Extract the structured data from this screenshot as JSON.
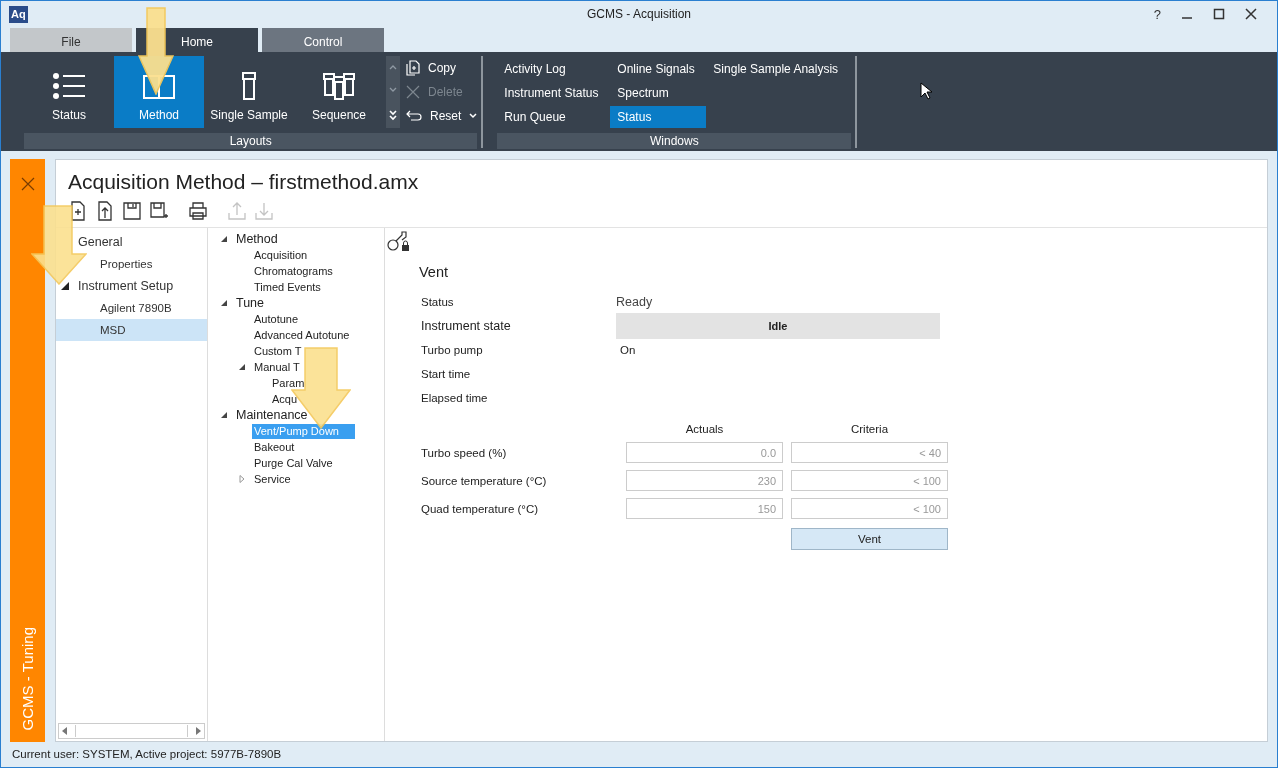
{
  "window": {
    "logo_text": "Aq",
    "title": "GCMS - Acquisition",
    "help": "?"
  },
  "ribbon_tabs": [
    {
      "label": "File",
      "selected": false
    },
    {
      "label": "Home",
      "selected": true
    },
    {
      "label": "Control",
      "selected": false
    }
  ],
  "layouts": {
    "label": "Layouts",
    "items": [
      {
        "label": "Status",
        "kind": "list",
        "selected": false
      },
      {
        "label": "Method",
        "kind": "book",
        "selected": true
      },
      {
        "label": "Single Sample",
        "kind": "vial",
        "selected": false
      },
      {
        "label": "Sequence",
        "kind": "vials",
        "selected": false
      }
    ]
  },
  "edit_actions": [
    {
      "label": "Copy",
      "kind": "copy",
      "disabled": false
    },
    {
      "label": "Delete",
      "kind": "delete",
      "disabled": true
    },
    {
      "label": "Reset",
      "kind": "reset",
      "disabled": false
    }
  ],
  "windows": {
    "label": "Windows",
    "items": [
      {
        "label": "Activity Log",
        "selected": false
      },
      {
        "label": "Instrument Status",
        "selected": false
      },
      {
        "label": "Run Queue",
        "selected": false
      },
      {
        "label": "Online Signals",
        "selected": false
      },
      {
        "label": "Spectrum",
        "selected": false
      },
      {
        "label": "Status",
        "selected": true
      },
      {
        "label": "Single Sample Analysis",
        "selected": false
      }
    ]
  },
  "side_panel": {
    "title": "GCMS - Tuning"
  },
  "document": {
    "title": "Acquisition Method – firstmethod.amx",
    "toolbar": [
      {
        "kind": "new",
        "disabled": false
      },
      {
        "kind": "open",
        "disabled": false
      },
      {
        "kind": "save",
        "disabled": false
      },
      {
        "kind": "save-as",
        "disabled": false
      },
      {
        "kind": "print",
        "disabled": false
      },
      {
        "kind": "upload",
        "disabled": true
      },
      {
        "kind": "download",
        "disabled": true
      }
    ]
  },
  "left_tree": [
    {
      "label": "General",
      "selected": false,
      "children": [
        {
          "label": "Properties",
          "selected": false
        }
      ]
    },
    {
      "label": "Instrument Setup",
      "expanded": true,
      "selected": false,
      "children": [
        {
          "label": "Agilent 7890B",
          "selected": false
        },
        {
          "label": "MSD",
          "selected": true
        }
      ]
    }
  ],
  "middle_tree": [
    {
      "label": "Method",
      "expanded": true,
      "selected": false,
      "children": [
        {
          "label": "Acquisition",
          "selected": false
        },
        {
          "label": "Chromatograms",
          "selected": false
        },
        {
          "label": "Timed Events",
          "selected": false
        }
      ]
    },
    {
      "label": "Tune",
      "expanded": true,
      "selected": false,
      "children": [
        {
          "label": "Autotune",
          "selected": false
        },
        {
          "label": "Advanced Autotune",
          "selected": false
        },
        {
          "label": "Custom T",
          "selected": false
        },
        {
          "label": "Manual T",
          "expanded": true,
          "selected": false,
          "children": [
            {
              "label": "Param",
              "selected": false
            },
            {
              "label": "Acqu",
              "selected": false
            }
          ]
        }
      ]
    },
    {
      "label": "Maintenance",
      "expanded": true,
      "selected": false,
      "children": [
        {
          "label": "Vent/Pump Down",
          "selected": true
        },
        {
          "label": "Bakeout",
          "selected": false
        },
        {
          "label": "Purge Cal Valve",
          "selected": false
        },
        {
          "label": "Service",
          "expanded": false,
          "selected": false
        }
      ]
    }
  ],
  "vent": {
    "title": "Vent",
    "status_rows": [
      {
        "label": "Status",
        "value": "Ready",
        "kind": "text"
      },
      {
        "label": "Instrument state",
        "value": "Idle",
        "kind": "state"
      },
      {
        "label": "Turbo pump",
        "value": "On",
        "kind": "text"
      },
      {
        "label": "Start time",
        "kind": "text"
      },
      {
        "label": "Elapsed time",
        "kind": "text"
      }
    ],
    "columns": [
      "Actuals",
      "Criteria"
    ],
    "measurements": [
      {
        "label": "Turbo speed (%)",
        "actual": "0.0",
        "criteria": "< 40"
      },
      {
        "label": "Source temperature (°C)",
        "actual": "230",
        "criteria": "< 100"
      },
      {
        "label": "Quad temperature (°C)",
        "actual": "150",
        "criteria": "< 100"
      }
    ],
    "button": "Vent"
  },
  "status_bar": "Current user: SYSTEM, Active project: 5977B-7890B"
}
